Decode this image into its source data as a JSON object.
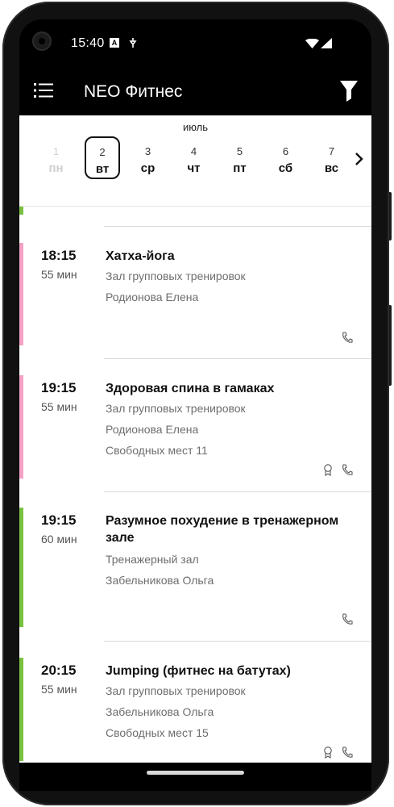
{
  "status": {
    "time": "15:40",
    "notification_letter": "A"
  },
  "app": {
    "title": "NEO Фитнес"
  },
  "calendar": {
    "month": "июль",
    "days": [
      {
        "num": "1",
        "weekday": "пн"
      },
      {
        "num": "2",
        "weekday": "вт"
      },
      {
        "num": "3",
        "weekday": "ср"
      },
      {
        "num": "4",
        "weekday": "чт"
      },
      {
        "num": "5",
        "weekday": "пт"
      },
      {
        "num": "6",
        "weekday": "сб"
      },
      {
        "num": "7",
        "weekday": "вс"
      }
    ],
    "selected_index": 1,
    "disabled_index": 0
  },
  "classes": [
    {
      "time": "18:15",
      "duration": "55 мин",
      "title": "Хатха-йога",
      "room": "Зал групповых тренировок",
      "trainer": "Родионова Елена",
      "places": "",
      "color": "#f5a3c7",
      "icons": [
        "phone-icon"
      ]
    },
    {
      "time": "19:15",
      "duration": "55 мин",
      "title": "Здоровая спина в гамаках",
      "room": "Зал групповых тренировок",
      "trainer": "Родионова Елена",
      "places": "Свободных мест 11",
      "color": "#f5a3c7",
      "icons": [
        "award-icon",
        "phone-icon"
      ]
    },
    {
      "time": "19:15",
      "duration": "60 мин",
      "title": "Разумное похудение в тренажерном зале",
      "room": "Тренажерный зал",
      "trainer": "Забельникова Ольга",
      "places": "",
      "color": "#7cc242",
      "icons": [
        "phone-icon"
      ]
    },
    {
      "time": "20:15",
      "duration": "55 мин",
      "title": "Jumping (фитнес на батутах)",
      "room": "Зал групповых тренировок",
      "trainer": "Забельникова Ольга",
      "places": "Свободных мест 15",
      "color": "#7cc242",
      "icons": [
        "award-icon",
        "phone-icon"
      ]
    }
  ]
}
